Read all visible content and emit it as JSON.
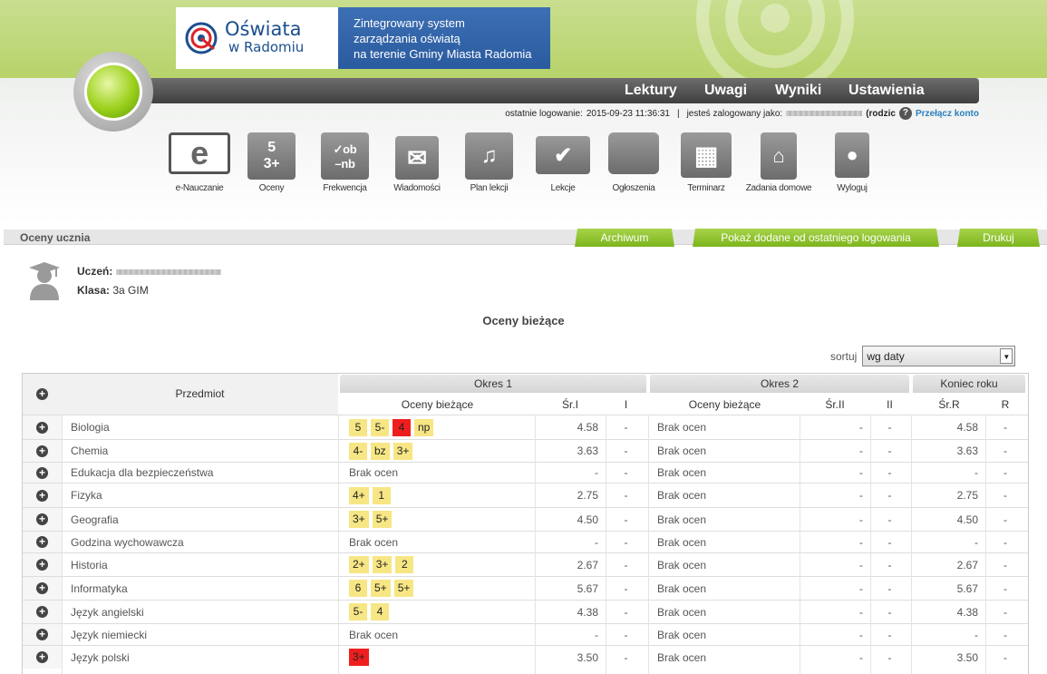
{
  "banner": {
    "logo_title": "Oświata",
    "logo_sub": "w Radomiu",
    "tagline": [
      "Zintegrowany system",
      "zarządzania oświatą",
      "na terenie Gminy Miasta Radomia"
    ]
  },
  "menu": [
    "Lektury",
    "Uwagi",
    "Wyniki",
    "Ustawienia"
  ],
  "login": {
    "last_login_label": "ostatnie logowanie:",
    "last_login_value": "2015-09-23 11:36:31",
    "separator": "|",
    "logged_as": "jesteś zalogowany jako:",
    "role": "(rodzic",
    "help": "?",
    "switch": "Przełącz konto"
  },
  "icons": [
    {
      "name": "e-nauczanie",
      "label": "e-Nauczanie",
      "glyph": "e"
    },
    {
      "name": "oceny",
      "label": "Oceny",
      "glyph": "5 3+"
    },
    {
      "name": "frekwencja",
      "label": "Frekwencja",
      "glyph": "ob nb"
    },
    {
      "name": "wiadomosci",
      "label": "Wiadomości",
      "glyph": "✉"
    },
    {
      "name": "plan-lekcji",
      "label": "Plan lekcji",
      "glyph": "🔔"
    },
    {
      "name": "lekcje",
      "label": "Lekcje",
      "glyph": "✔"
    },
    {
      "name": "ogloszenia",
      "label": "Ogłoszenia",
      "glyph": ""
    },
    {
      "name": "terminarz",
      "label": "Terminarz",
      "glyph": "▦"
    },
    {
      "name": "zadania-domowe",
      "label": "Zadania domowe",
      "glyph": "⌂"
    },
    {
      "name": "wyloguj",
      "label": "Wyloguj",
      "glyph": "🔒"
    }
  ],
  "section": {
    "title": "Oceny ucznia",
    "buttons": [
      "Archiwum",
      "Pokaż dodane od ostatniego logowania",
      "Drukuj"
    ]
  },
  "student": {
    "name_label": "Uczeń:",
    "class_label": "Klasa:",
    "class_value": "3a GIM"
  },
  "page_subtitle": "Oceny bieżące",
  "sort": {
    "label": "sortuj",
    "value": "wg daty"
  },
  "table": {
    "header_subject": "Przedmiot",
    "period1": "Okres 1",
    "period2": "Okres 2",
    "year_end": "Koniec roku",
    "cols": {
      "current": "Oceny bieżące",
      "avg1": "Śr.I",
      "final1": "I",
      "avg2": "Śr.II",
      "final2": "II",
      "avgR": "Śr.R",
      "finalR": "R"
    },
    "rows": [
      {
        "subject": "Biologia",
        "grades": [
          {
            "v": "5"
          },
          {
            "v": "5-"
          },
          {
            "v": "4",
            "red": true
          },
          {
            "v": "np"
          }
        ],
        "avg1": "4.58",
        "f1": "-",
        "p2": "Brak ocen",
        "avg2": "-",
        "f2": "-",
        "avgR": "4.58",
        "fR": "-"
      },
      {
        "subject": "Chemia",
        "grades": [
          {
            "v": "4-"
          },
          {
            "v": "bz"
          },
          {
            "v": "3+"
          }
        ],
        "avg1": "3.63",
        "f1": "-",
        "p2": "Brak ocen",
        "avg2": "-",
        "f2": "-",
        "avgR": "3.63",
        "fR": "-"
      },
      {
        "subject": "Edukacja dla bezpieczeństwa",
        "none": "Brak ocen",
        "grades": [],
        "avg1": "-",
        "f1": "-",
        "p2": "Brak ocen",
        "avg2": "-",
        "f2": "-",
        "avgR": "-",
        "fR": "-"
      },
      {
        "subject": "Fizyka",
        "grades": [
          {
            "v": "4+"
          },
          {
            "v": "1"
          }
        ],
        "avg1": "2.75",
        "f1": "-",
        "p2": "Brak ocen",
        "avg2": "-",
        "f2": "-",
        "avgR": "2.75",
        "fR": "-"
      },
      {
        "subject": "Geografia",
        "grades": [
          {
            "v": "3+"
          },
          {
            "v": "5+"
          }
        ],
        "avg1": "4.50",
        "f1": "-",
        "p2": "Brak ocen",
        "avg2": "-",
        "f2": "-",
        "avgR": "4.50",
        "fR": "-"
      },
      {
        "subject": "Godzina wychowawcza",
        "none": "Brak ocen",
        "grades": [],
        "avg1": "-",
        "f1": "-",
        "p2": "Brak ocen",
        "avg2": "-",
        "f2": "-",
        "avgR": "-",
        "fR": "-"
      },
      {
        "subject": "Historia",
        "grades": [
          {
            "v": "2+"
          },
          {
            "v": "3+"
          },
          {
            "v": "2"
          }
        ],
        "avg1": "2.67",
        "f1": "-",
        "p2": "Brak ocen",
        "avg2": "-",
        "f2": "-",
        "avgR": "2.67",
        "fR": "-"
      },
      {
        "subject": "Informatyka",
        "grades": [
          {
            "v": "6"
          },
          {
            "v": "5+"
          },
          {
            "v": "5+"
          }
        ],
        "avg1": "5.67",
        "f1": "-",
        "p2": "Brak ocen",
        "avg2": "-",
        "f2": "-",
        "avgR": "5.67",
        "fR": "-"
      },
      {
        "subject": "Język angielski",
        "grades": [
          {
            "v": "5-"
          },
          {
            "v": "4"
          }
        ],
        "avg1": "4.38",
        "f1": "-",
        "p2": "Brak ocen",
        "avg2": "-",
        "f2": "-",
        "avgR": "4.38",
        "fR": "-"
      },
      {
        "subject": "Język niemiecki",
        "none": "Brak ocen",
        "grades": [],
        "avg1": "-",
        "f1": "-",
        "p2": "Brak ocen",
        "avg2": "-",
        "f2": "-",
        "avgR": "-",
        "fR": "-"
      },
      {
        "subject": "Język polski",
        "grades": [
          {
            "v": "3+",
            "red": true
          }
        ],
        "avg1": "3.50",
        "f1": "-",
        "p2": "Brak ocen",
        "avg2": "-",
        "f2": "-",
        "avgR": "3.50",
        "fR": "-"
      }
    ]
  },
  "colors": {
    "accent_green": "#8cc22a",
    "grade_yellow": "#f7e684",
    "grade_red": "#ef1e1e",
    "link_blue": "#2a7fbd"
  }
}
